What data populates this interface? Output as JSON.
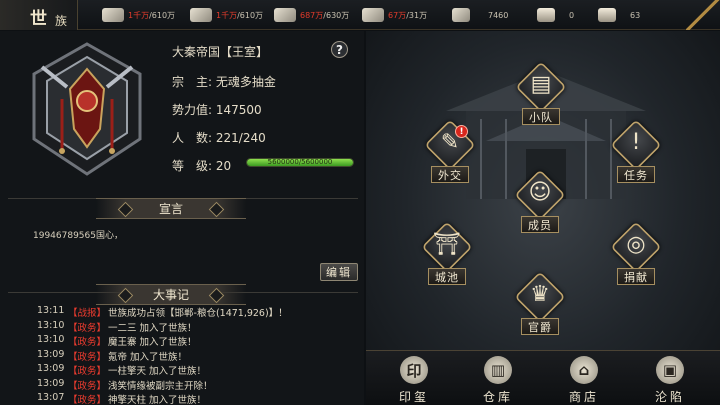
{
  "topbar": {
    "title_main": "世",
    "title_sub": "族",
    "resources": [
      {
        "icon": "wood-icon",
        "current": "1千万",
        "max": "/610万"
      },
      {
        "icon": "iron-icon",
        "current": "1千万",
        "max": "/610万"
      },
      {
        "icon": "stone-icon",
        "current": "687万",
        "max": "/630万"
      },
      {
        "icon": "grain-icon",
        "current": "67万",
        "max": "/31万"
      },
      {
        "icon": "sword-icon",
        "current": "",
        "max": "7460"
      },
      {
        "icon": "gold-ingot-icon",
        "current": "",
        "max": "0"
      },
      {
        "icon": "silver-ingot-icon",
        "current": "",
        "max": "63"
      }
    ]
  },
  "clan": {
    "name": "大秦帝国【王室】",
    "leader_label": "宗　主:",
    "leader_value": "无魂多抽金",
    "power_label": "势力值:",
    "power_value": "147500",
    "members_label": "人　数:",
    "members_value": "221/240",
    "level_label": "等　级:",
    "level_value": "20",
    "exp_text": "5600000/5600000",
    "exp_fraction": 1.0
  },
  "announcement": {
    "header": "宣言",
    "text": "19946789565国心，",
    "edit_label": "编辑"
  },
  "events": {
    "header": "大事记",
    "items": [
      {
        "time": "13:11",
        "tag": "【战报】",
        "tag_color": "red",
        "msg": "世族成功占领【邯郸-粮仓(1471,926)】！"
      },
      {
        "time": "13:10",
        "tag": "【政务】",
        "tag_color": "red",
        "msg": "一二三 加入了世族！"
      },
      {
        "time": "13:10",
        "tag": "【政务】",
        "tag_color": "red",
        "msg": "魔王寨 加入了世族！"
      },
      {
        "time": "13:09",
        "tag": "【政务】",
        "tag_color": "red",
        "msg": "氪帝 加入了世族！"
      },
      {
        "time": "13:09",
        "tag": "【政务】",
        "tag_color": "red",
        "msg": "一柱擎天 加入了世族！"
      },
      {
        "time": "13:09",
        "tag": "【政务】",
        "tag_color": "red",
        "msg": "浅笑情缘被副宗主开除！"
      },
      {
        "time": "13:07",
        "tag": "【政务】",
        "tag_color": "red",
        "msg": "神擎天柱 加入了世族！"
      }
    ]
  },
  "map_nodes": {
    "squad": "小队",
    "diplomacy": "外交",
    "tasks": "任务",
    "members": "成员",
    "cities": "城池",
    "donate": "捐献",
    "ranks": "官爵",
    "diplomacy_alert": "!"
  },
  "bottom_nav": {
    "seal": "印玺",
    "warehouse": "仓库",
    "shop": "商店",
    "fallen": "沦陷"
  }
}
